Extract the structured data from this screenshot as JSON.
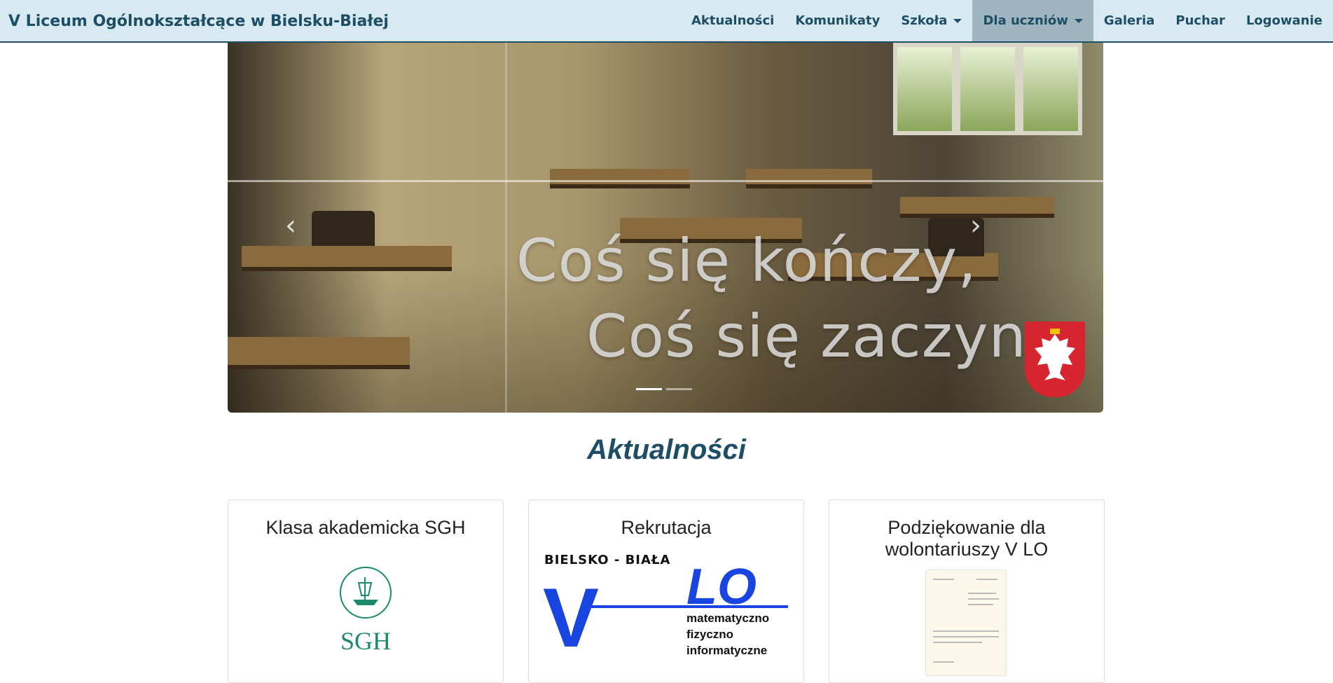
{
  "navbar": {
    "brand": "V Liceum Ogólnokształcące w Bielsku-Białej",
    "items": [
      {
        "label": "Aktualności"
      },
      {
        "label": "Komunikaty"
      },
      {
        "label": "Szkoła"
      },
      {
        "label": "Dla uczniów"
      },
      {
        "label": "Galeria"
      },
      {
        "label": "Puchar"
      },
      {
        "label": "Logowanie"
      }
    ]
  },
  "carousel": {
    "line1": "Coś się kończy,",
    "line2": "Coś się zaczyna.",
    "prev_icon": "chevron-left-icon",
    "next_icon": "chevron-right-icon",
    "indicator_count": 2,
    "active_indicator": 1
  },
  "news": {
    "title": "Aktualności",
    "cards": [
      {
        "title": "Klasa akademicka SGH",
        "logo_text": "SGH"
      },
      {
        "title": "Rekrutacja",
        "logo_top": "BIELSKO - BIAŁA",
        "logo_v": "V",
        "logo_lo": "LO",
        "logo_sub1": "matematyczno",
        "logo_sub2": "fizyczno",
        "logo_sub3": "informatyczne"
      },
      {
        "title": "Podziękowanie dla wolontariuszy V LO"
      }
    ]
  },
  "colors": {
    "navbar_bg": "#d7eaf2",
    "brand": "#1e4d66",
    "active_nav": "#9fb5bf",
    "vlo_blue": "#1845e0",
    "sgh_green": "#1a8a6a"
  }
}
